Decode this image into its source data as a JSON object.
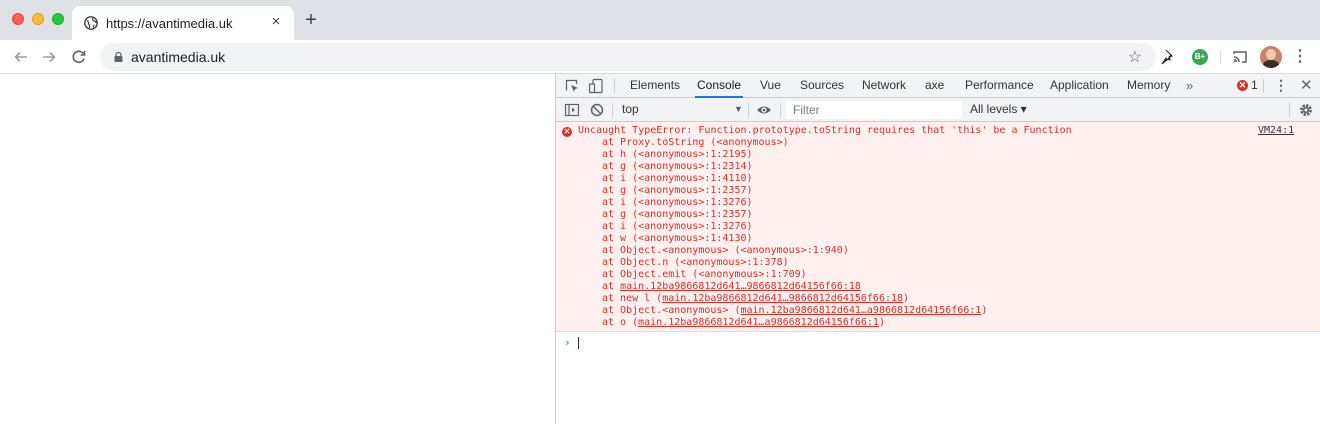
{
  "browser": {
    "tab_title": "https://avantimedia.uk",
    "tab_close": "×",
    "new_tab": "+",
    "url": "avantimedia.uk",
    "ext_badge": "B+"
  },
  "devtools": {
    "tabs": [
      "Elements",
      "Console",
      "Vue",
      "Sources",
      "Network",
      "axe",
      "Performance",
      "Application",
      "Memory"
    ],
    "active_tab": "Console",
    "more": "»",
    "error_count": "1",
    "close": "✕",
    "context": "top",
    "filter_placeholder": "Filter",
    "levels": "All levels ▾"
  },
  "console": {
    "error_message": "Uncaught TypeError: Function.prototype.toString requires that 'this' be a Function",
    "error_source": "VM24:1",
    "frames": [
      {
        "text": "at Proxy.toString (<anonymous>)"
      },
      {
        "text": "at h (<anonymous>:1:2195)"
      },
      {
        "text": "at g (<anonymous>:1:2314)"
      },
      {
        "text": "at i (<anonymous>:1:4110)"
      },
      {
        "text": "at g (<anonymous>:1:2357)"
      },
      {
        "text": "at i (<anonymous>:1:3276)"
      },
      {
        "text": "at g (<anonymous>:1:2357)"
      },
      {
        "text": "at i (<anonymous>:1:3276)"
      },
      {
        "text": "at w (<anonymous>:1:4130)"
      },
      {
        "text": "at Object.<anonymous> (<anonymous>:1:940)"
      },
      {
        "text": "at Object.n (<anonymous>:1:378)"
      },
      {
        "text": "at Object.emit (<anonymous>:1:709)"
      },
      {
        "prefix": "at ",
        "link": "main.12ba9866812d641…9866812d64156f66:18",
        "suffix": ""
      },
      {
        "prefix": "at new l (",
        "link": "main.12ba9866812d641…9866812d64156f66:18",
        "suffix": ")"
      },
      {
        "prefix": "at Object.<anonymous> (",
        "link": "main.12ba9866812d641…a9866812d64156f66:1",
        "suffix": ")"
      },
      {
        "prefix": "at o (",
        "link": "main.12ba9866812d641…a9866812d64156f66:1",
        "suffix": ")"
      }
    ]
  }
}
